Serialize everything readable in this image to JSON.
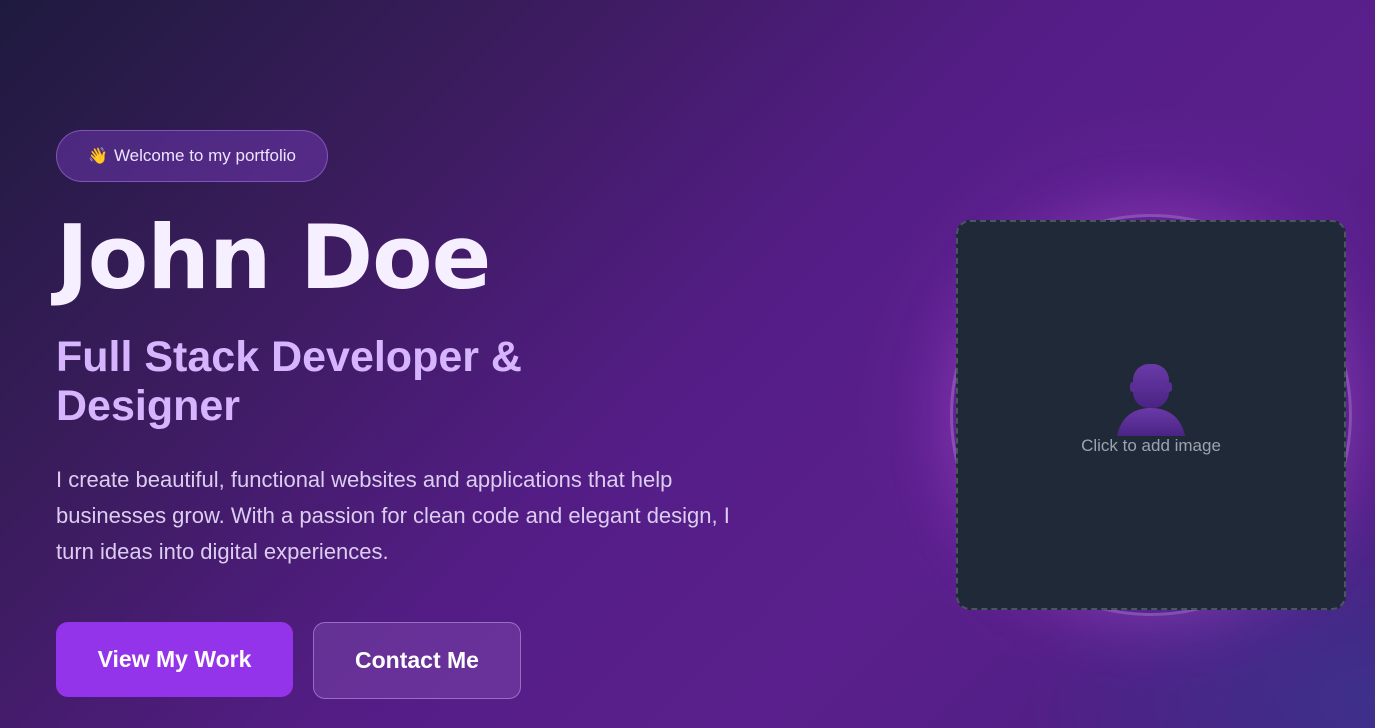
{
  "hero": {
    "badge_emoji": "👋",
    "badge_text": "Welcome to my portfolio",
    "name": "John Doe",
    "role": "Full Stack Developer & Designer",
    "intro": "I create beautiful, functional websites and applications that help businesses grow. With a passion for clean code and elegant design, I turn ideas into digital experiences.",
    "primary_button": "View My Work",
    "secondary_button": "Contact Me"
  },
  "profile_image": {
    "placeholder_label": "Click to add image",
    "icon": "person-icon"
  },
  "colors": {
    "accent": "#9333ea",
    "role_text": "#d6b4fe",
    "image_box_bg": "#1f2937"
  }
}
